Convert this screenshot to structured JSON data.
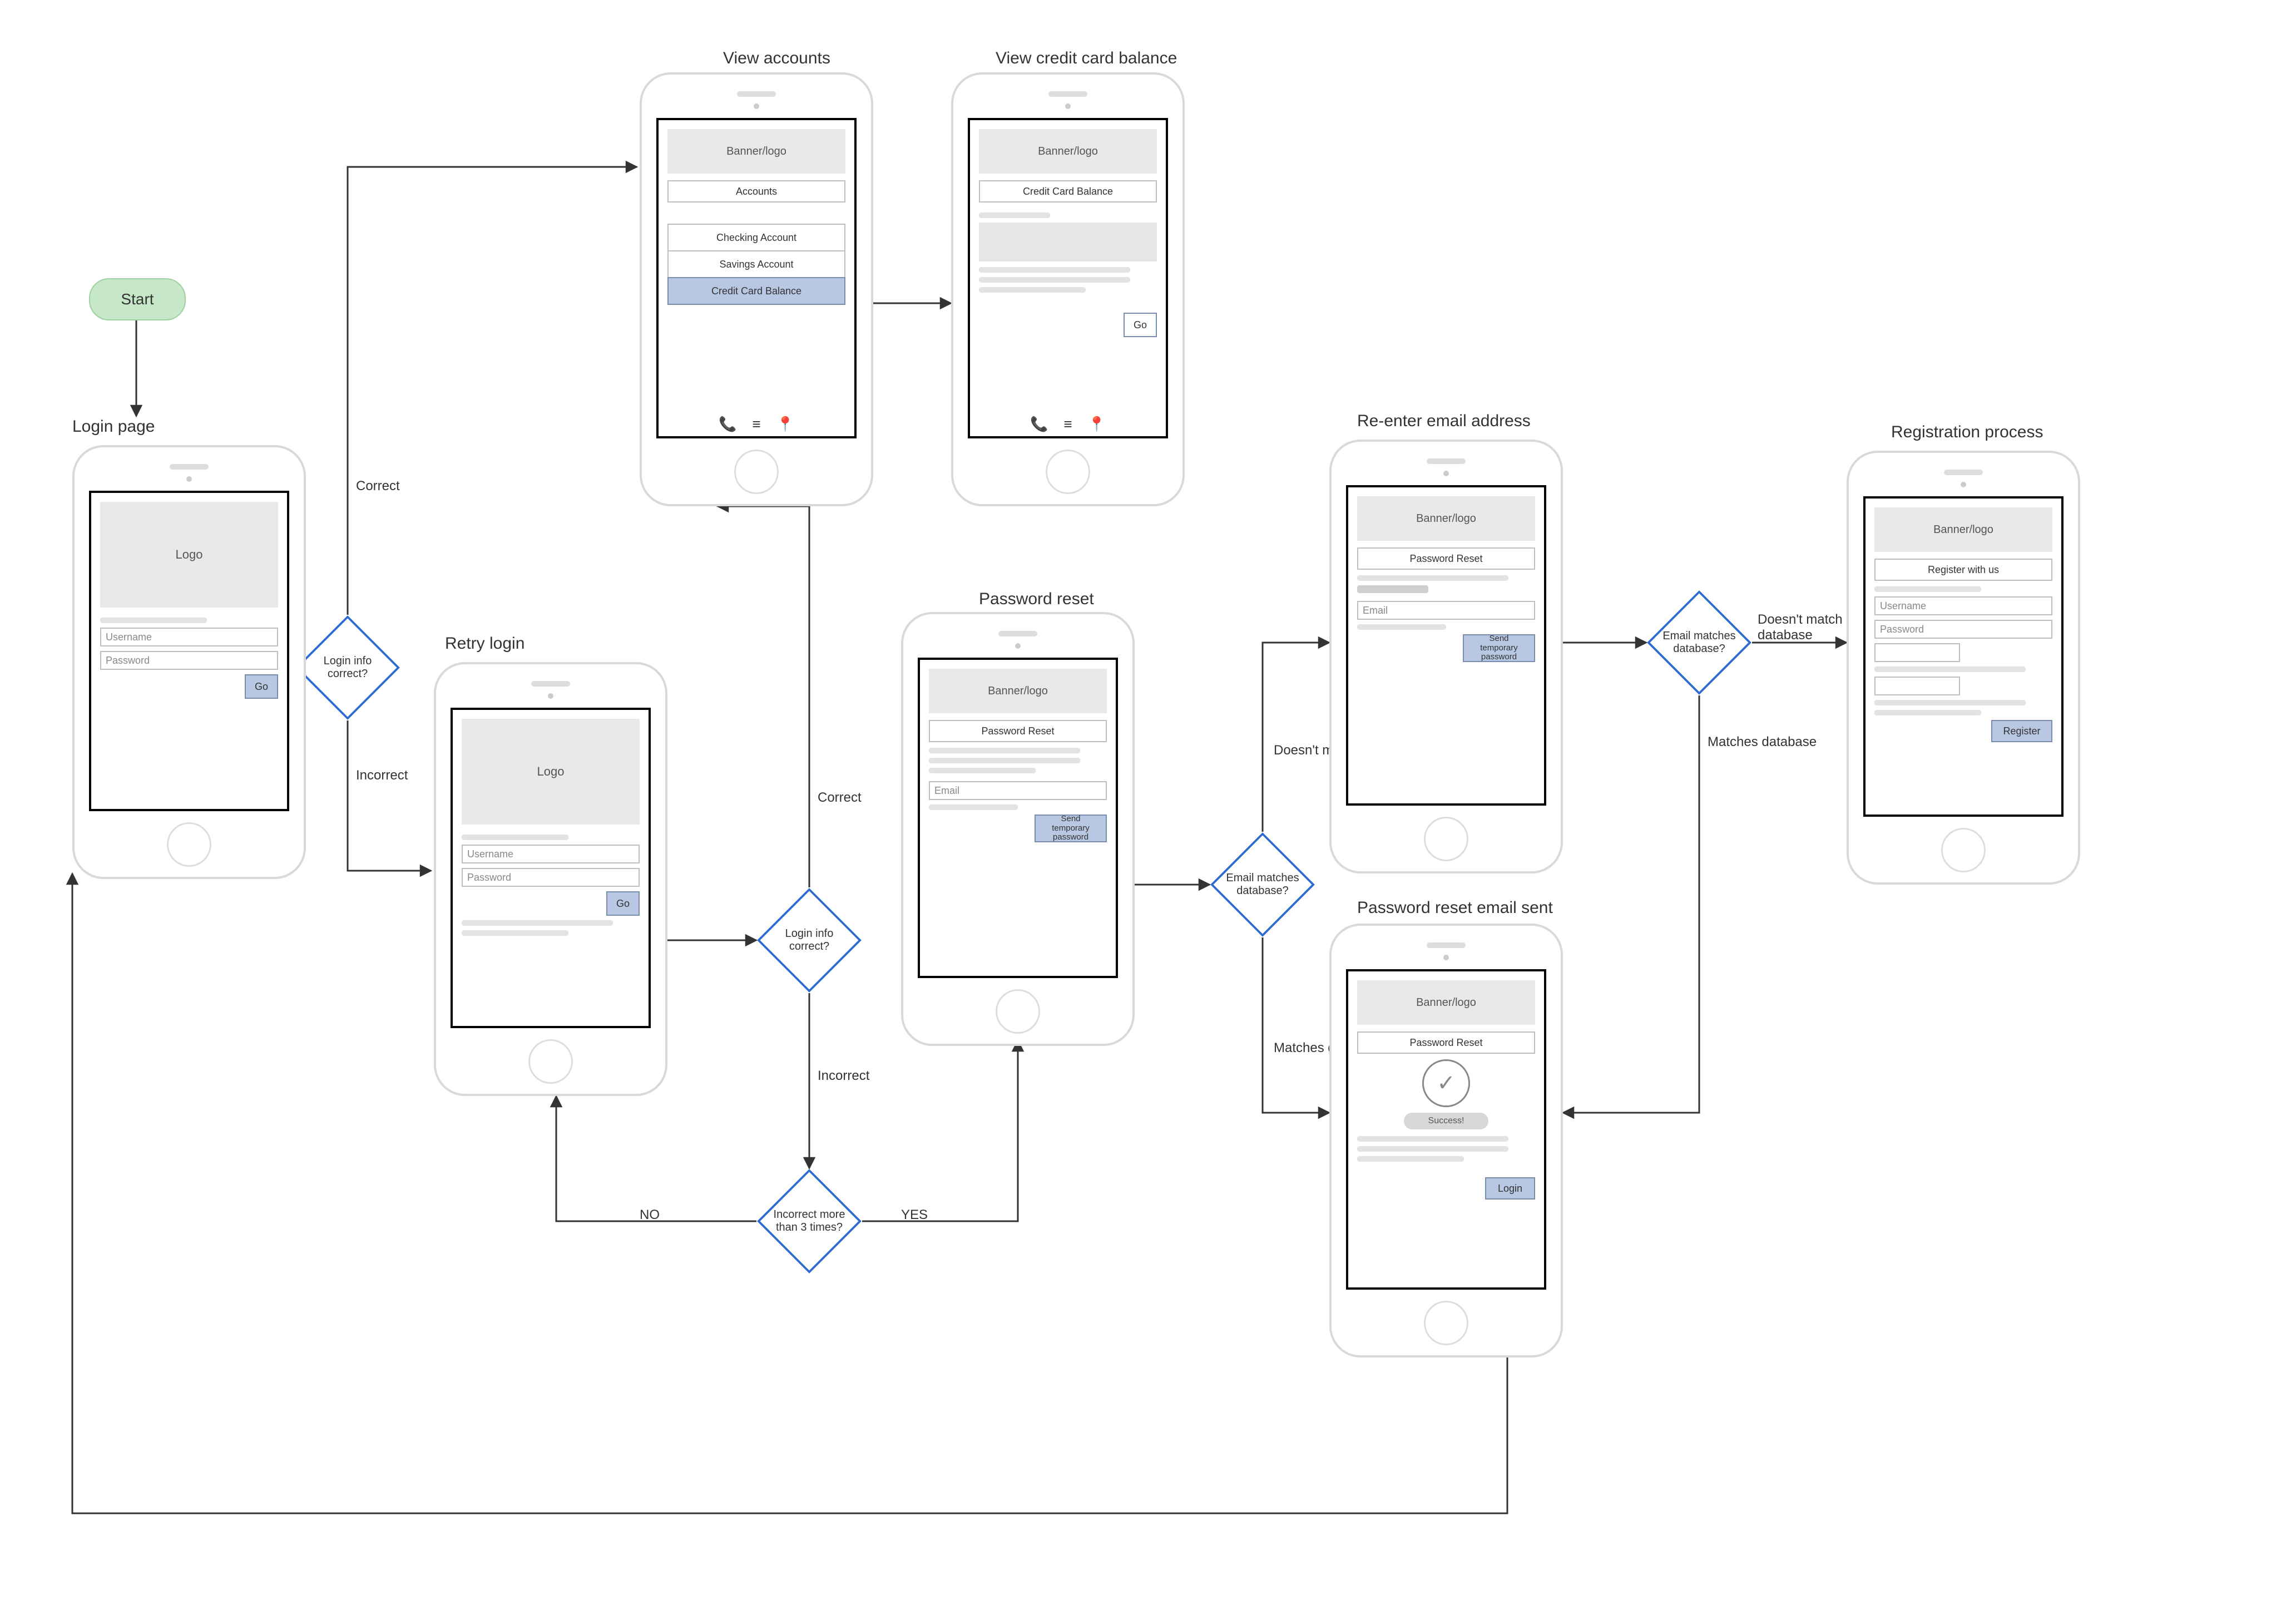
{
  "start": {
    "label": "Start"
  },
  "screens": {
    "login": {
      "title": "Login page",
      "logo": "Logo",
      "username_ph": "Username",
      "password_ph": "Password",
      "go": "Go"
    },
    "retry": {
      "title": "Retry login",
      "logo": "Logo",
      "username_ph": "Username",
      "password_ph": "Password",
      "go": "Go"
    },
    "accounts": {
      "title": "View accounts",
      "banner": "Banner/logo",
      "header": "Accounts",
      "row1": "Checking Account",
      "row2": "Savings Account",
      "row3": "Credit Card Balance"
    },
    "cc_balance": {
      "title": "View credit card balance",
      "banner": "Banner/logo",
      "header": "Credit Card Balance",
      "go": "Go"
    },
    "pw_reset": {
      "title": "Password reset",
      "banner": "Banner/logo",
      "header": "Password Reset",
      "email_ph": "Email",
      "send": "Send temporary password"
    },
    "reenter_email": {
      "title": "Re-enter email address",
      "banner": "Banner/logo",
      "header": "Password Reset",
      "email_ph": "Email",
      "send": "Send temporary password"
    },
    "pw_sent": {
      "title": "Password reset email sent",
      "banner": "Banner/logo",
      "header": "Password Reset",
      "success": "Success!",
      "login": "Login"
    },
    "register": {
      "title": "Registration process",
      "banner": "Banner/logo",
      "header": "Register with us",
      "username_ph": "Username",
      "password_ph": "Password",
      "register": "Register"
    }
  },
  "decisions": {
    "login_correct_1": "Login info correct?",
    "login_correct_2": "Login info correct?",
    "more_than_3": "Incorrect more than 3 times?",
    "email_match_1": "Email matches database?",
    "email_match_2": "Email matches database?"
  },
  "edges": {
    "correct": "Correct",
    "incorrect": "Incorrect",
    "no": "NO",
    "yes": "YES",
    "matches": "Matches database",
    "not_match": "Doesn't match database",
    "not_match2": "Doesn't match database"
  },
  "icons": {
    "phone": "📞",
    "menu": "≡",
    "pin": "📍",
    "check": "✓"
  }
}
